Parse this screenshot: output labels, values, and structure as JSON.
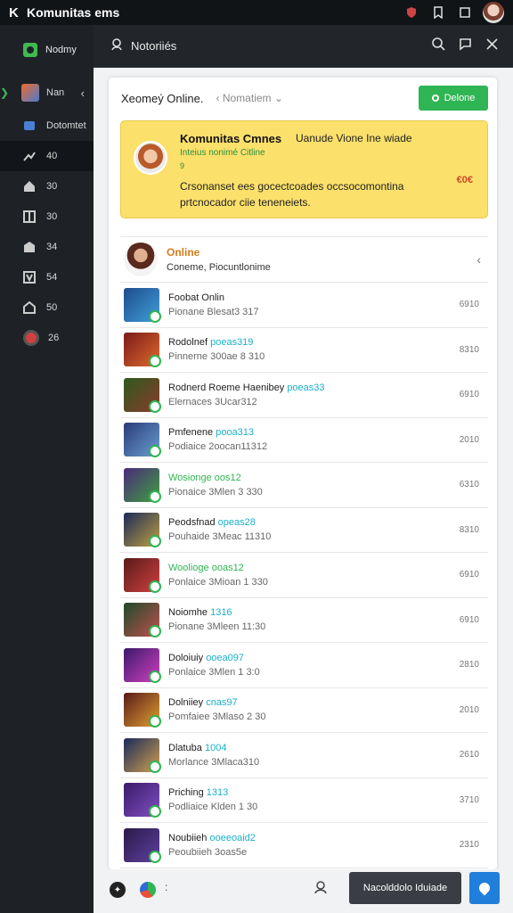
{
  "titlebar": {
    "back_glyph": "K",
    "title": "Komunitas ems"
  },
  "sidebar": {
    "top_label": "Nodmy",
    "items": [
      {
        "label": "Nan",
        "icon": "game-icon"
      },
      {
        "label": "Dotomtet",
        "icon": "chat-icon"
      },
      {
        "label": "40",
        "icon": "chart-icon"
      },
      {
        "label": "30",
        "icon": "home-icon"
      },
      {
        "label": "30",
        "icon": "grid-icon"
      },
      {
        "label": "34",
        "icon": "store-icon"
      },
      {
        "label": "54",
        "icon": "v-icon"
      },
      {
        "label": "50",
        "icon": "house-icon"
      },
      {
        "label": "26",
        "icon": "record-icon"
      }
    ]
  },
  "header": {
    "title": "Notoriiés"
  },
  "panel": {
    "title": "Xeomeý Online.",
    "dropdown": "Nomatiem",
    "online_button": "Delone"
  },
  "notice": {
    "title": "Komunitas Cmnes",
    "subtitle": "Uanude Vione Ine wiade",
    "tag": "Inteius nonimé Citline",
    "num": "9",
    "body": "Crsonanset ees gocectcoades occsocomontina prtcnocador ciie teneneiets.",
    "badge": "€0€"
  },
  "first_friend": {
    "name": "Online",
    "sub": "Coneme, Piocuntlonime"
  },
  "friends": [
    {
      "name": "Foobat Onlin",
      "highlight": "",
      "sub": "Pionane Blesat3 317",
      "count": "6910",
      "thumb": [
        "#1e4b8c",
        "#3fa0d8"
      ]
    },
    {
      "name": "Rodolnef ",
      "highlight": "poeas319",
      "sub": "Pinnerne 300ae 8 310",
      "count": "8310",
      "thumb": [
        "#7a1b1b",
        "#e06a2a"
      ]
    },
    {
      "name": "Rodnerd Roeme Haenibey ",
      "highlight": "poeas33",
      "sub": "Elernaces 3Ucar312",
      "count": "6910",
      "thumb": [
        "#2d5a1e",
        "#8b3a2a"
      ]
    },
    {
      "name": "Pmfenene ",
      "highlight": "pooa313",
      "sub": "Podiaice 2oocan11312",
      "count": "2010",
      "thumb": [
        "#2a3a7a",
        "#6aa0d0"
      ]
    },
    {
      "name": "",
      "highlight": "Wosionge oos12",
      "sub": "Pionaice 3Mlen 3 330",
      "count": "6310",
      "thumb": [
        "#4a2a7a",
        "#3fa040"
      ]
    },
    {
      "name": "Peodsfnad ",
      "highlight": "opeas28",
      "sub": "Pouhaide 3Meac 11310",
      "count": "8310",
      "thumb": [
        "#1a2a5a",
        "#c0a040"
      ]
    },
    {
      "name": "",
      "highlight": "Woolioge ooas12",
      "sub": "Ponlaice 3Mioan 1 330",
      "count": "6910",
      "thumb": [
        "#5a1a1a",
        "#d04040"
      ]
    },
    {
      "name": "Noiomhe ",
      "highlight": "1316",
      "sub": "Pionane 3Mleen 11:30",
      "count": "6910",
      "thumb": [
        "#1e4a2a",
        "#c05050"
      ]
    },
    {
      "name": "Doloiuiy ",
      "highlight": "ooea097",
      "sub": "Ponlaice 3Mlen 1 3:0",
      "count": "2810",
      "thumb": [
        "#3a1a6a",
        "#d040c0"
      ]
    },
    {
      "name": "Dolniiey ",
      "highlight": "cnas97",
      "sub": "Pomfaiee 3Mlaso 2 30",
      "count": "2010",
      "thumb": [
        "#5a1a1a",
        "#e0a030"
      ]
    },
    {
      "name": "Dlatuba ",
      "highlight": "1004",
      "sub": "Morlance 3Mlaca310",
      "count": "2610",
      "thumb": [
        "#1a2a5a",
        "#d0a050"
      ]
    },
    {
      "name": "Priching ",
      "highlight": "1313",
      "sub": "Podliaice Klden 1 30",
      "count": "3710",
      "thumb": [
        "#3a1a6a",
        "#8050c0"
      ]
    },
    {
      "name": "Noubiieh ",
      "highlight": "ooeeoaid2",
      "sub": "Peoubiieh 3oas5e",
      "count": "2310",
      "thumb": [
        "#2a1a4a",
        "#6040a0"
      ]
    }
  ],
  "bottom": {
    "dots": ":",
    "message_button": "Nacolddolo Iduiade"
  }
}
